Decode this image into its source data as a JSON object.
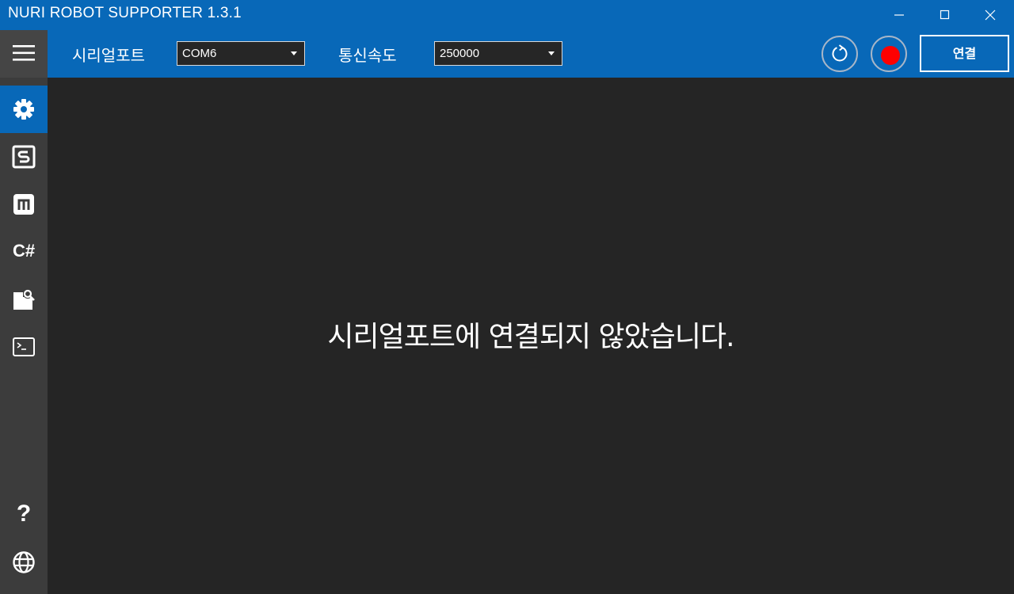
{
  "window": {
    "title": "NURI ROBOT SUPPORTER 1.3.1"
  },
  "toolbar": {
    "port_label": "시리얼포트",
    "port_value": "COM6",
    "baud_label": "통신속도",
    "baud_value": "250000",
    "connect_label": "연결",
    "record_color": "#ff0000"
  },
  "sidebar": {
    "items": [
      {
        "icon": "gear-icon",
        "active": true
      },
      {
        "icon": "s-box-icon",
        "active": false
      },
      {
        "icon": "m-box-icon",
        "active": false
      },
      {
        "icon": "csharp-icon",
        "label": "C#",
        "active": false
      },
      {
        "icon": "file-search-icon",
        "active": false
      },
      {
        "icon": "terminal-icon",
        "active": false
      }
    ],
    "help_label": "?",
    "bottom_icon": "globe-icon"
  },
  "main": {
    "status_message": "시리얼포트에 연결되지 않았습니다."
  },
  "colors": {
    "accent": "#0868b8",
    "background": "#252525",
    "sidebar": "#3c3c3c"
  }
}
